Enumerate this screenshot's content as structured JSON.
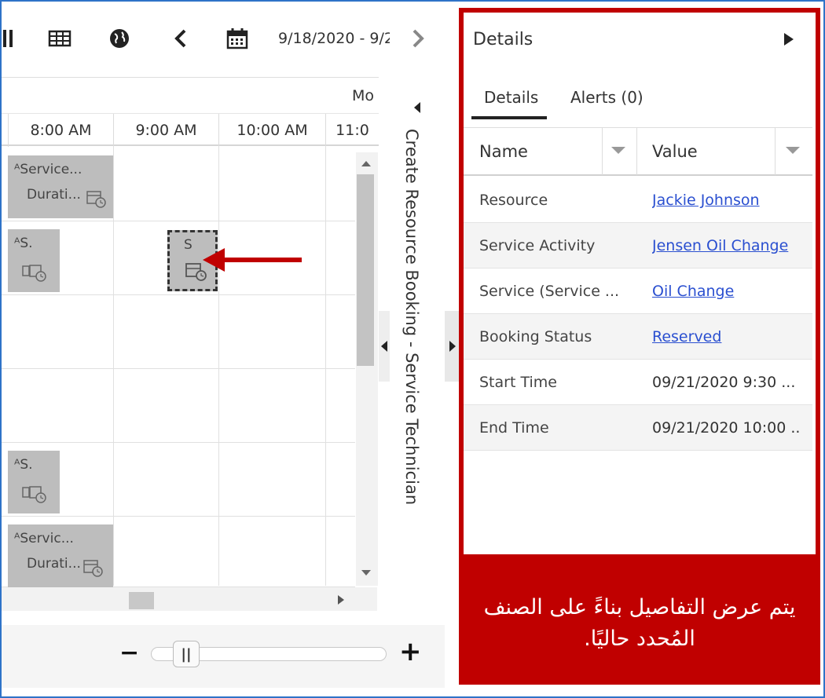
{
  "toolbar": {
    "date_range": "9/18/2020 - 9/2",
    "icons": [
      "columns-icon",
      "grid-icon",
      "globe-icon",
      "chevron-left-icon",
      "calendar-icon",
      "chevron-right-icon"
    ]
  },
  "schedule": {
    "day_label": "Mo",
    "hours": [
      "8:00 AM",
      "9:00 AM",
      "10:00 AM",
      "11:0"
    ],
    "bookings": [
      {
        "line1": "ᴬService...",
        "line2": "Durati..."
      },
      {
        "line1": "ᴬS."
      },
      {
        "line1": "S"
      },
      {
        "line1": "ᴬS."
      },
      {
        "line1": "ᴬServic...",
        "line2": "Durati..."
      }
    ]
  },
  "side_panel": {
    "title": "Create Resource Booking - Service Technician"
  },
  "details": {
    "title": "Details",
    "tabs": [
      "Details",
      "Alerts (0)"
    ],
    "columns": [
      "Name",
      "Value"
    ],
    "rows": [
      {
        "name": "Resource",
        "value": "Jackie Johnson",
        "link": true
      },
      {
        "name": "Service Activity",
        "value": "Jensen Oil Change",
        "link": true
      },
      {
        "name": "Service (Service ...",
        "value": "Oil Change",
        "link": true
      },
      {
        "name": "Booking Status",
        "value": "Reserved",
        "link": true
      },
      {
        "name": "Start Time",
        "value": "09/21/2020 9:30 ...",
        "link": false
      },
      {
        "name": "End Time",
        "value": "09/21/2020 10:00 ...",
        "link": false
      }
    ]
  },
  "annotation": {
    "text": "يتم عرض التفاصيل بناءً على الصنف المُحدد حاليًا.",
    "color": "#c00000",
    "arrow_color": "#c00000"
  },
  "zoom": {
    "minus": "−",
    "plus": "+",
    "thumb": "||"
  }
}
